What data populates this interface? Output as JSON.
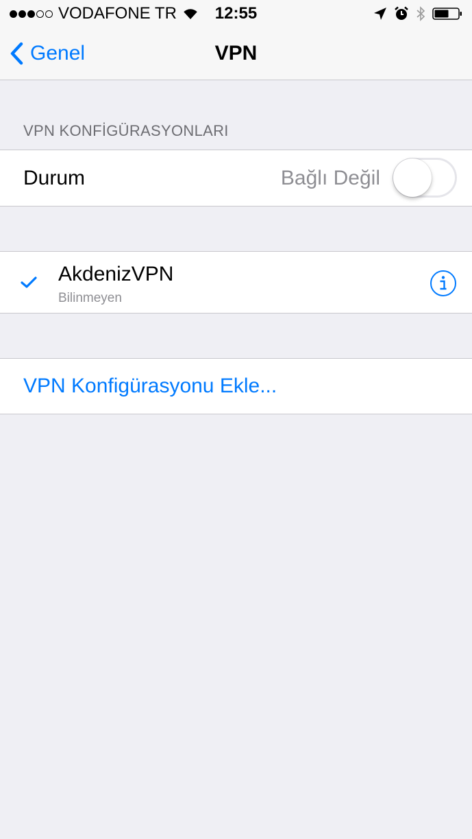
{
  "status_bar": {
    "carrier": "VODAFONE TR",
    "time": "12:55",
    "signal_bars_filled": 3,
    "signal_bars_total": 5,
    "icons": [
      "wifi-icon",
      "location-arrow-icon",
      "alarm-icon",
      "bluetooth-icon",
      "battery-icon"
    ]
  },
  "nav": {
    "back_label": "Genel",
    "title": "VPN"
  },
  "section": {
    "header": "VPN KONFİGÜRASYONLARI"
  },
  "status_row": {
    "label": "Durum",
    "value": "Bağlı Değil",
    "toggle_on": false
  },
  "vpn_item": {
    "name": "AkdenizVPN",
    "subtitle": "Bilinmeyen",
    "selected": true
  },
  "add_config": {
    "label": "VPN Konfigürasyonu Ekle..."
  },
  "colors": {
    "accent": "#007aff",
    "background": "#efeff4",
    "secondary_text": "#8e8e93",
    "separator": "#c8c7cc"
  }
}
